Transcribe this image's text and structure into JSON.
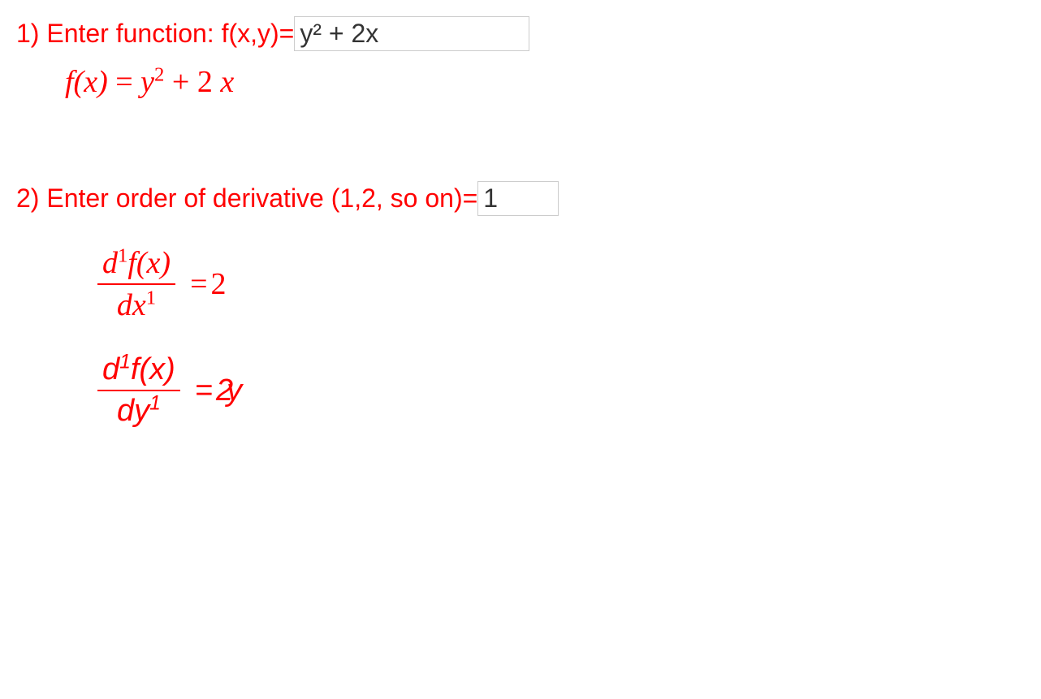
{
  "prompt1": {
    "label": "1) Enter function: f(x,y)=",
    "value": "y² + 2x"
  },
  "fx_display": {
    "lhs": "f(x)",
    "eq": " = ",
    "rhs_y": "y",
    "rhs_exp": "2",
    "rhs_plus": " + 2 ",
    "rhs_x": "x"
  },
  "prompt2": {
    "label": "2) Enter order of derivative (1,2, so on)=",
    "value": "1"
  },
  "deriv_x": {
    "num_d": "d",
    "num_exp": "1",
    "num_f": "f(x)",
    "den_d": "dx",
    "den_exp": "1",
    "eq": " = ",
    "result": "2"
  },
  "deriv_y": {
    "num_d": "d",
    "num_exp": "1",
    "num_f": "f(x)",
    "den_d": "dy",
    "den_exp": "1",
    "eq": " = ",
    "result_coef": "2 ",
    "result_var": "y"
  }
}
